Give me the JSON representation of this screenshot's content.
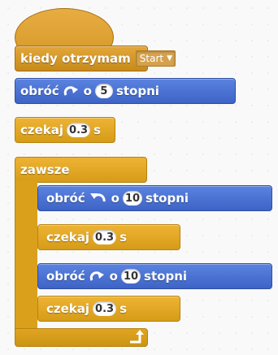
{
  "script": {
    "hat": {
      "label": "kiedy otrzymam",
      "message": "Start"
    },
    "turn1": {
      "label": "obróć",
      "direction": "clockwise",
      "connector": "o",
      "value": "5",
      "unit": "stopni"
    },
    "wait1": {
      "label": "czekaj",
      "value": "0.3",
      "unit": "s"
    },
    "forever": {
      "label": "zawsze",
      "inner": {
        "turn_a": {
          "label": "obróć",
          "direction": "counter-clockwise",
          "connector": "o",
          "value": "10",
          "unit": "stopni"
        },
        "wait_a": {
          "label": "czekaj",
          "value": "0.3",
          "unit": "s"
        },
        "turn_b": {
          "label": "obróć",
          "direction": "clockwise",
          "connector": "o",
          "value": "10",
          "unit": "stopni"
        },
        "wait_b": {
          "label": "czekaj",
          "value": "0.3",
          "unit": "s"
        }
      }
    }
  },
  "colors": {
    "events": "#d69c28",
    "motion": "#4a6cd4",
    "control": "#e1a91a",
    "workspace": "#f9f9f9"
  },
  "icons": {
    "turn_clockwise": "rotate-clockwise-icon",
    "turn_counter_clockwise": "rotate-counter-clockwise-icon",
    "dropdown": "dropdown-arrow-icon",
    "loop": "loop-arrow-icon"
  }
}
